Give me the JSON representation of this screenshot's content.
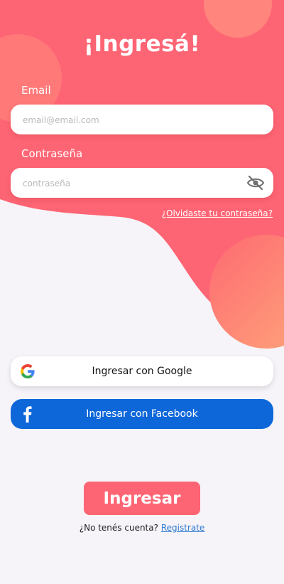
{
  "title": "¡Ingresá!",
  "email": {
    "label": "Email",
    "placeholder": "email@email.com",
    "value": ""
  },
  "password": {
    "label": "Contraseña",
    "placeholder": "contraseña",
    "value": "",
    "toggle_icon": "eye-off-icon"
  },
  "forgot_link": "¿Olvidaste tu contraseña?",
  "google_button": {
    "label": "Ingresar con Google",
    "icon": "google-icon"
  },
  "facebook_button": {
    "label": "Ingresar con Facebook",
    "icon": "facebook-icon"
  },
  "login_button": "Ingresar",
  "register": {
    "prompt": "¿No tenés cuenta?",
    "link": "Registrate"
  },
  "colors": {
    "primary": "#fe6574",
    "facebook": "#0d67d9",
    "background": "#f6f4f8",
    "link": "#2f79d2"
  }
}
